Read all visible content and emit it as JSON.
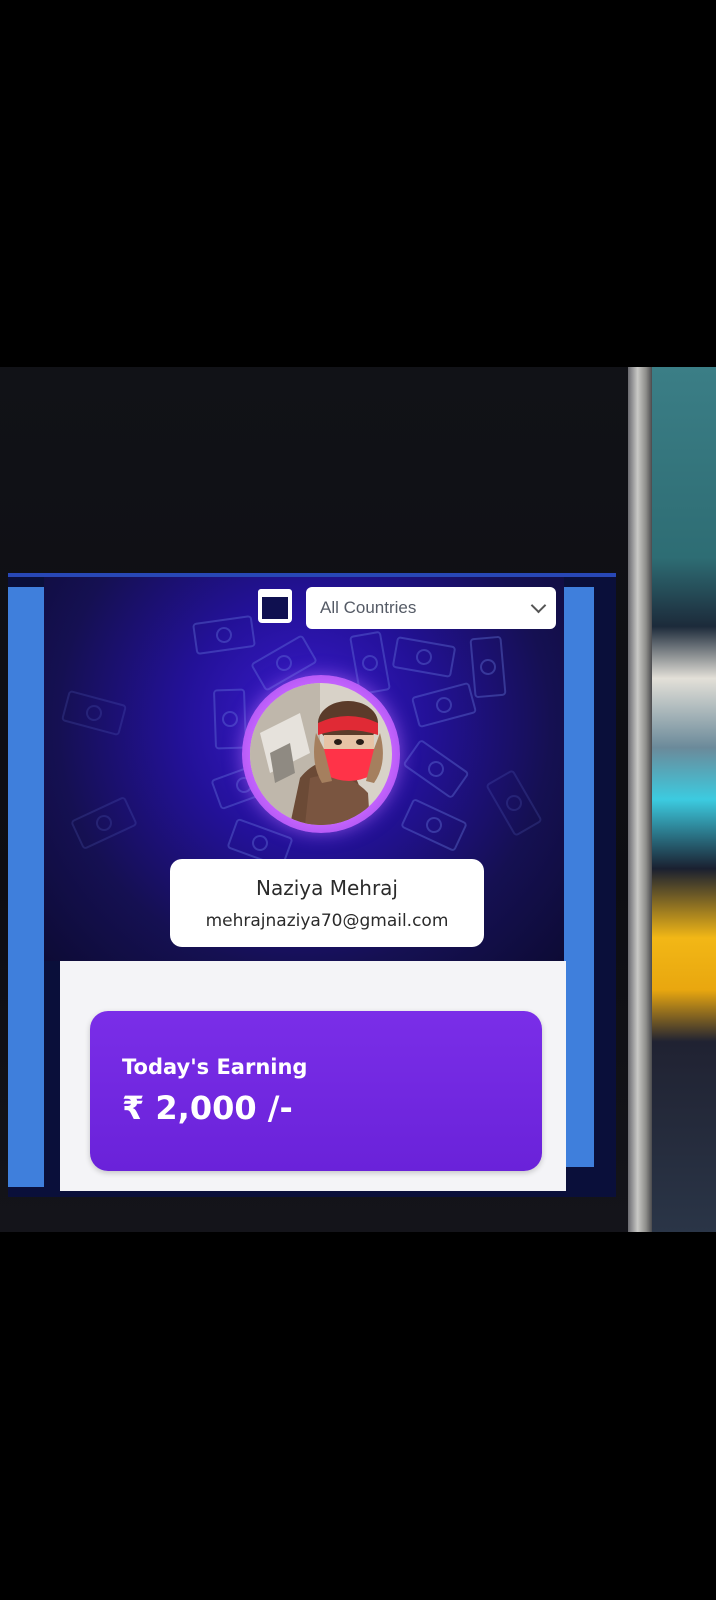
{
  "filter": {
    "country_value": "All Countries",
    "calendar_icon": "calendar-icon",
    "chevron_icon": "chevron-down-icon"
  },
  "profile": {
    "name": "Naziya Mehraj",
    "email": "mehrajnaziya70@gmail.com",
    "avatar_icon": "avatar"
  },
  "earning": {
    "label": "Today's Earning",
    "amount": "₹ 2,000 /-"
  },
  "colors": {
    "hero_bg": "#231198",
    "accent_purple": "#6a22d9",
    "side_blue": "#3f7fdc",
    "avatar_ring": "#c866ff"
  }
}
